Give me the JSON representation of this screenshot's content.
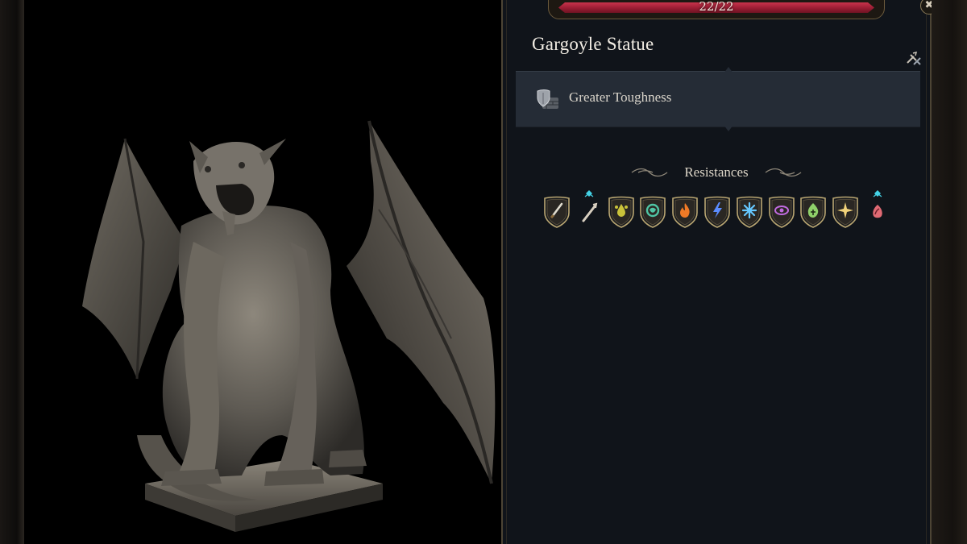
{
  "hp": {
    "text": "22/22",
    "current": 22,
    "max": 22,
    "bar_color": "#b0253d"
  },
  "close": {
    "glyph": "✖",
    "icon": "close-icon"
  },
  "creature": {
    "name": "Gargoyle Statue",
    "portrait_subject": "stone gargoyle statue with bat wings on a square pedestal"
  },
  "swap_icon": "swap-weapons-icon",
  "features": [
    {
      "label": "Greater Toughness",
      "icon": "shield-brick-icon"
    }
  ],
  "resistances": {
    "title": "Resistances",
    "items": [
      {
        "icon": "slashing-icon",
        "color": "#e0dccf",
        "shield": true
      },
      {
        "icon": "piercing-icon",
        "color": "#d8cfc0",
        "shield": false,
        "marker": true
      },
      {
        "icon": "acid-icon",
        "color": "#c9c23a",
        "shield": true
      },
      {
        "icon": "poison-icon",
        "color": "#4fc4a4",
        "shield": true
      },
      {
        "icon": "fire-icon",
        "color": "#f07a26",
        "shield": true
      },
      {
        "icon": "lightning-icon",
        "color": "#5b8cff",
        "shield": true
      },
      {
        "icon": "cold-icon",
        "color": "#66c8ff",
        "shield": true
      },
      {
        "icon": "psychic-icon",
        "color": "#c06be0",
        "shield": true
      },
      {
        "icon": "necrotic-icon",
        "color": "#8fd06a",
        "shield": true
      },
      {
        "icon": "radiant-icon",
        "color": "#f1d27a",
        "shield": true
      },
      {
        "icon": "force-icon",
        "color": "#e06a74",
        "shield": false,
        "marker": true
      }
    ]
  }
}
